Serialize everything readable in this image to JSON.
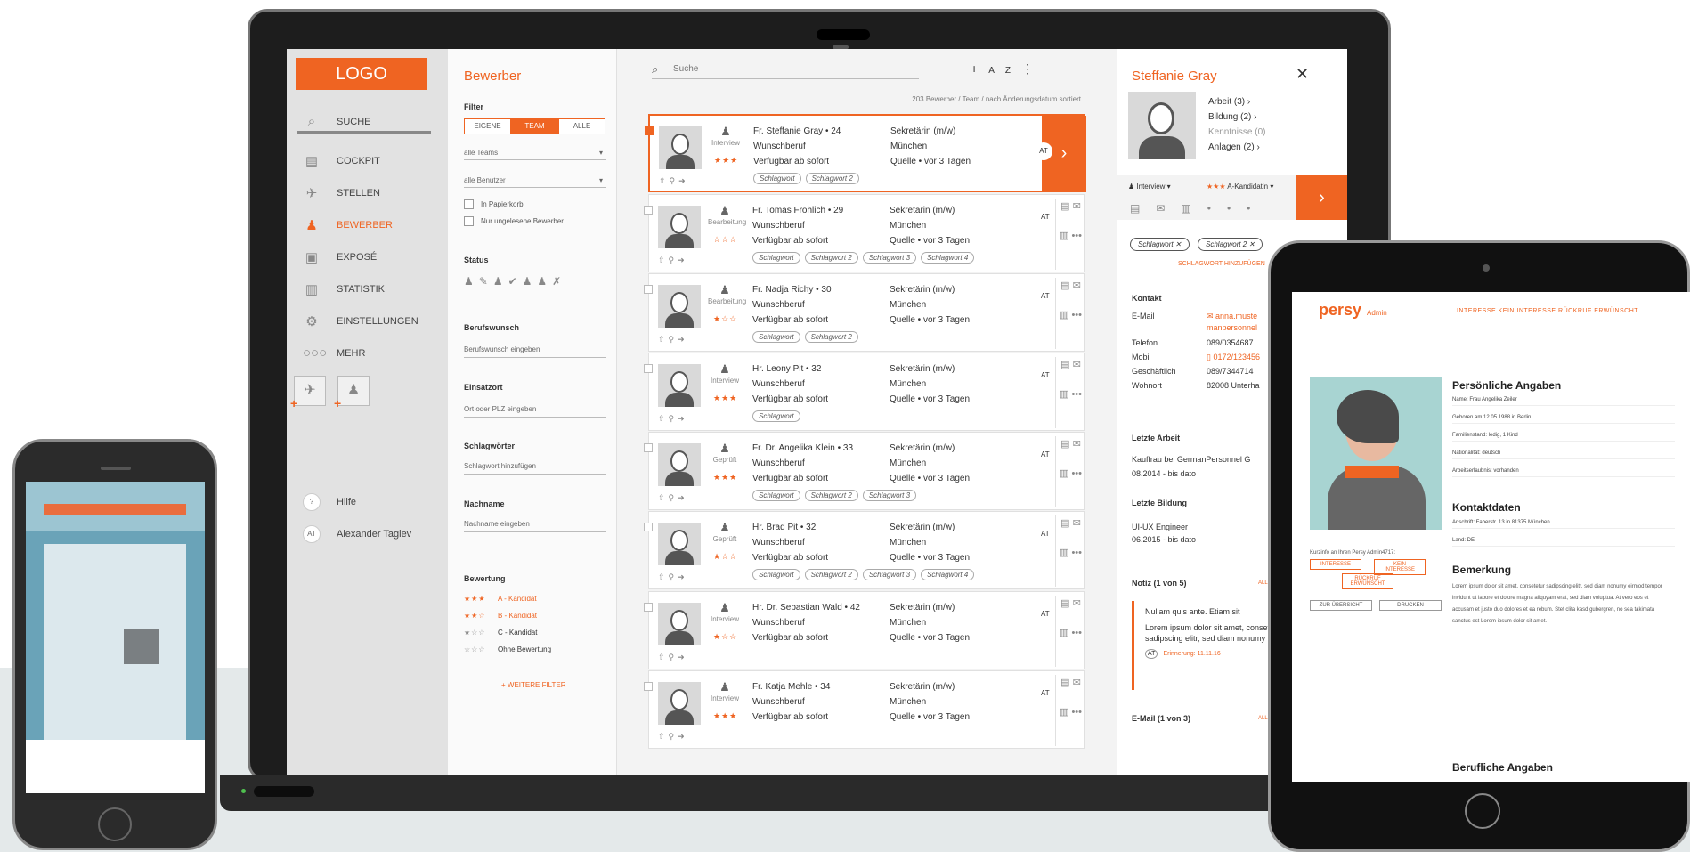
{
  "sidebar": {
    "logo": "LOGO",
    "items": [
      {
        "label": "SUCHE",
        "icon": "search-icon"
      },
      {
        "label": "COCKPIT",
        "icon": "cockpit-icon"
      },
      {
        "label": "STELLEN",
        "icon": "stellen-icon"
      },
      {
        "label": "BEWERBER",
        "icon": "bewerber-icon"
      },
      {
        "label": "EXPOSÉ",
        "icon": "expose-icon"
      },
      {
        "label": "STATISTIK",
        "icon": "statistik-icon"
      },
      {
        "label": "EINSTELLUNGEN",
        "icon": "gear-icon"
      },
      {
        "label": "MEHR",
        "icon": "more-icon"
      }
    ],
    "help": "Hilfe",
    "user_initials": "AT",
    "user_name": "Alexander Tagiev"
  },
  "filter": {
    "title": "Bewerber",
    "filter_label": "Filter",
    "segments": [
      "EIGENE",
      "TEAM",
      "ALLE"
    ],
    "active_segment": "TEAM",
    "teams": "alle Teams",
    "users": "alle Benutzer",
    "checkbox_papierkorb": "In Papierkorb",
    "checkbox_ungelesen": "Nur ungelesene Bewerber",
    "status_label": "Status",
    "berufswunsch_label": "Berufswunsch",
    "berufswunsch_placeholder": "Berufswunsch eingeben",
    "einsatzort_label": "Einsatzort",
    "einsatzort_placeholder": "Ort oder PLZ eingeben",
    "schlagwoerter_label": "Schlagwörter",
    "schlagwoerter_placeholder": "Schlagwort hinzufügen",
    "nachname_label": "Nachname",
    "nachname_placeholder": "Nachname eingeben",
    "bewertung_label": "Bewertung",
    "ratings": [
      {
        "stars": "★★★",
        "label": "A - Kandidat"
      },
      {
        "stars": "★★☆",
        "label": "B - Kandidat"
      },
      {
        "stars": "★☆☆",
        "label": "C - Kandidat"
      },
      {
        "stars": "☆☆☆",
        "label": "Ohne Bewertung"
      }
    ],
    "more_filters": "+ WEITERE FILTER"
  },
  "main": {
    "search_placeholder": "Suche",
    "sort_info": "203 Bewerber / Team / nach Änderungsdatum sortiert",
    "applicants": [
      {
        "name": "Fr. Steffanie Gray • 24",
        "status": "Interview",
        "stars": "★★★",
        "wunsch": "Wunschberuf",
        "avail": "Verfügbar ab sofort",
        "job": "Sekretärin (m/w)",
        "city": "München",
        "source": "Quelle  •  vor 3 Tagen",
        "tags": [
          "Schlagwort",
          "Schlagwort 2"
        ],
        "cc": "AT"
      },
      {
        "name": "Fr. Tomas Fröhlich • 29",
        "status": "Bearbeitung",
        "stars": "☆☆☆",
        "wunsch": "Wunschberuf",
        "avail": "Verfügbar ab sofort",
        "job": "Sekretärin (m/w)",
        "city": "München",
        "source": "Quelle  •  vor 3 Tagen",
        "tags": [
          "Schlagwort",
          "Schlagwort 2",
          "Schlagwort 3",
          "Schlagwort 4"
        ],
        "cc": "AT"
      },
      {
        "name": "Fr. Nadja Richy • 30",
        "status": "Bearbeitung",
        "stars": "★☆☆",
        "wunsch": "Wunschberuf",
        "avail": "Verfügbar ab sofort",
        "job": "Sekretärin (m/w)",
        "city": "München",
        "source": "Quelle  •  vor 3 Tagen",
        "tags": [
          "Schlagwort",
          "Schlagwort 2"
        ],
        "cc": "AT"
      },
      {
        "name": "Hr. Leony Pit • 32",
        "status": "Interview",
        "stars": "★★★",
        "wunsch": "Wunschberuf",
        "avail": "Verfügbar ab sofort",
        "job": "Sekretärin (m/w)",
        "city": "München",
        "source": "Quelle  •  vor 3 Tagen",
        "tags": [
          "Schlagwort"
        ],
        "cc": "AT"
      },
      {
        "name": "Fr. Dr. Angelika Klein • 33",
        "status": "Geprüft",
        "stars": "★★★",
        "wunsch": "Wunschberuf",
        "avail": "Verfügbar ab sofort",
        "job": "Sekretärin (m/w)",
        "city": "München",
        "source": "Quelle  •  vor 3 Tagen",
        "tags": [
          "Schlagwort",
          "Schlagwort 2",
          "Schlagwort 3"
        ],
        "cc": "AT"
      },
      {
        "name": "Hr. Brad Pit • 32",
        "status": "Geprüft",
        "stars": "★☆☆",
        "wunsch": "Wunschberuf",
        "avail": "Verfügbar ab sofort",
        "job": "Sekretärin (m/w)",
        "city": "München",
        "source": "Quelle  •  vor 3 Tagen",
        "tags": [
          "Schlagwort",
          "Schlagwort 2",
          "Schlagwort 3",
          "Schlagwort 4"
        ],
        "cc": "AT"
      },
      {
        "name": "Hr. Dr. Sebastian Wald • 42",
        "status": "Interview",
        "stars": "★☆☆",
        "wunsch": "Wunschberuf",
        "avail": "Verfügbar ab sofort",
        "job": "Sekretärin (m/w)",
        "city": "München",
        "source": "Quelle  •  vor 3 Tagen",
        "tags": [],
        "cc": "AT"
      },
      {
        "name": "Fr. Katja Mehle • 34",
        "status": "Interview",
        "stars": "★★★",
        "wunsch": "Wunschberuf",
        "avail": "Verfügbar ab sofort",
        "job": "Sekretärin (m/w)",
        "city": "München",
        "source": "Quelle  •  vor 3 Tagen",
        "tags": [],
        "cc": "AT"
      }
    ]
  },
  "detail": {
    "name": "Steffanie Gray",
    "links": [
      "Arbeit (3)",
      "Bildung (2)",
      "Kenntnisse (0)",
      "Anlagen (2)"
    ],
    "status": "Interview",
    "stars": "★★★",
    "rating": "A-Kandidatin",
    "tags": [
      "Schlagwort",
      "Schlagwort 2"
    ],
    "add_tag": "SCHLAGWORT HINZUFÜGEN",
    "kontakt_label": "Kontakt",
    "contact": [
      {
        "k": "E-Mail",
        "v": "anna.muste"
      },
      {
        "k": "",
        "v": "manpersonnel"
      },
      {
        "k": "Telefon",
        "v": "089/0354687"
      },
      {
        "k": "Mobil",
        "v": "0172/123456"
      },
      {
        "k": "Geschäftlich",
        "v": "089/7344714"
      },
      {
        "k": "Wohnort",
        "v": "82008 Unterha"
      }
    ],
    "letzte_arbeit_label": "Letzte Arbeit",
    "arbeit1": "Kauffrau bei GermanPersonnel G",
    "arbeit2": "08.2014 - bis dato",
    "letzte_bildung_label": "Letzte Bildung",
    "bildung1": "UI-UX Engineer",
    "bildung2": "06.2015 - bis dato",
    "notiz_label": "Notiz (1 von 5)",
    "alle": "ALLE",
    "note_title": "Nullam quis ante. Etiam sit",
    "note_body": "Lorem ipsum dolor sit amet, consete tur sadipscing elitr, sed diam nonumy eirmod...",
    "note_reminder": "Erinnerung: 11.11.16",
    "email_label": "E-Mail (1 von 3)"
  },
  "tablet": {
    "brand": "persy",
    "brand_sub": "Admin",
    "top_actions": "INTERESSE   KEIN INTERESSE   RÜCKRUF ERWÜNSCHT",
    "heading1": "Persönliche Angaben",
    "lines1": [
      "Name: Frau Angelika Zeiler",
      "Geboren am 12.05.1988 in Berlin",
      "Familienstand: ledig, 1 Kind",
      "Nationalität: deutsch",
      "Arbeitserlaubnis: vorhanden"
    ],
    "heading2": "Kontaktdaten",
    "lines2": [
      "Anschrift: Faberstr. 13 in 81375 München",
      "Land: DE"
    ],
    "heading3": "Bemerkung",
    "lorem": "Lorem ipsum dolor sit amet, consetetur sadipscing elitr, sed diam nonumy eirmod tempor invidunt ut labore et dolore magna aliquyam erat, sed diam voluptua. At vero eos et accusam et justo duo dolores et ea rebum. Stet clita kasd gubergren, no sea takimata sanctus est Lorem ipsum dolor sit amet.",
    "heading4": "Berufliche Angaben",
    "forward": "Kurzinfo an Ihren Persy Admin4717:",
    "btns": [
      "INTERESSE",
      "KEIN INTERESSE",
      "RÜCKRUF ERWÜNSCHT",
      "ZUR ÜBERSICHT",
      "DRUCKEN"
    ]
  }
}
